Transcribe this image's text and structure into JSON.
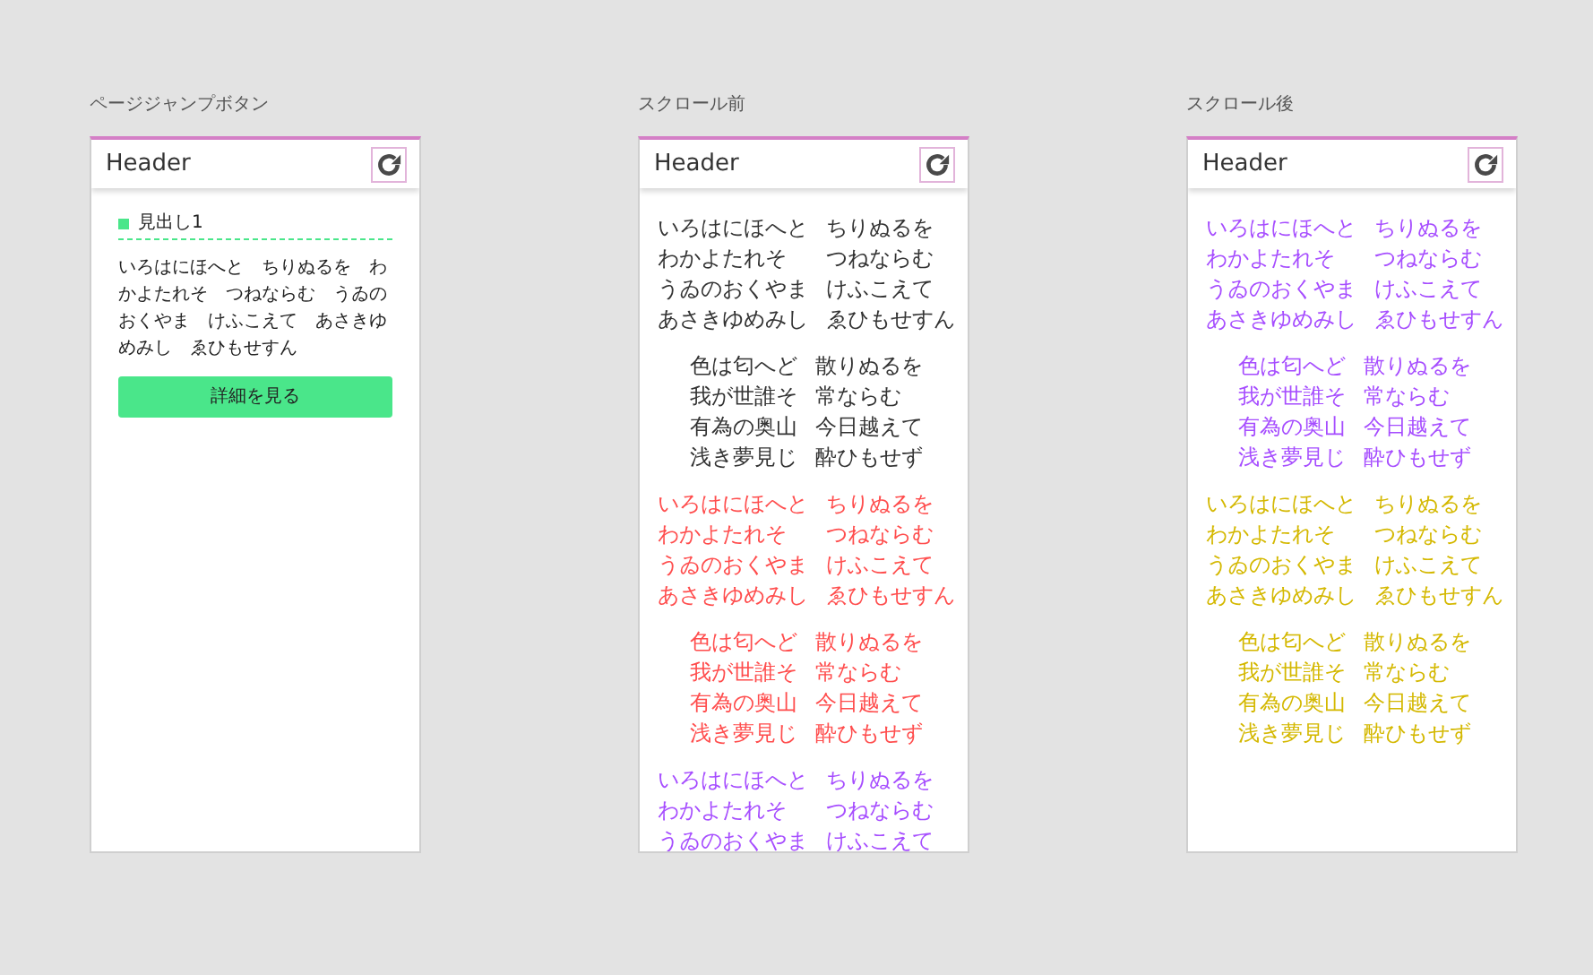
{
  "screens": [
    {
      "caption": "ページジャンプボタン",
      "header": {
        "title": "Header"
      },
      "kind": "detail",
      "heading": "見出し1",
      "body": "いろはにほへと　ちりぬるを　わかよたれそ　つねならむ　うゐのおくやま　けふこえて　あさきゆめみし　ゑひもせすん",
      "button": "詳細を見る"
    },
    {
      "caption": "スクロール前",
      "header": {
        "title": "Header"
      },
      "kind": "scroll",
      "stanzas": [
        {
          "kind": "kana",
          "color": "#333333",
          "lines": [
            [
              "いろはにほへと",
              "ちりぬるを"
            ],
            [
              "わかよたれそ",
              "つねならむ"
            ],
            [
              "うゐのおくやま",
              "けふこえて"
            ],
            [
              "あさきゆめみし",
              "ゑひもせすん"
            ]
          ]
        },
        {
          "kind": "kanji",
          "color": "#333333",
          "lines": [
            [
              "色は匂へど",
              "散りぬるを"
            ],
            [
              "我が世誰そ",
              "常ならむ"
            ],
            [
              "有為の奥山",
              "今日越えて"
            ],
            [
              "浅き夢見じ",
              "酔ひもせず"
            ]
          ]
        },
        {
          "kind": "kana",
          "color": "#ff4d4d",
          "lines": [
            [
              "いろはにほへと",
              "ちりぬるを"
            ],
            [
              "わかよたれそ",
              "つねならむ"
            ],
            [
              "うゐのおくやま",
              "けふこえて"
            ],
            [
              "あさきゆめみし",
              "ゑひもせすん"
            ]
          ]
        },
        {
          "kind": "kanji",
          "color": "#ff4d4d",
          "lines": [
            [
              "色は匂へど",
              "散りぬるを"
            ],
            [
              "我が世誰そ",
              "常ならむ"
            ],
            [
              "有為の奥山",
              "今日越えて"
            ],
            [
              "浅き夢見じ",
              "酔ひもせず"
            ]
          ]
        },
        {
          "kind": "kana",
          "color": "#a64dff",
          "lines": [
            [
              "いろはにほへと",
              "ちりぬるを"
            ],
            [
              "わかよたれそ",
              "つねならむ"
            ],
            [
              "うゐのおくやま",
              "けふこえて"
            ]
          ]
        }
      ]
    },
    {
      "caption": "スクロール後",
      "header": {
        "title": "Header"
      },
      "kind": "scroll",
      "stanzas": [
        {
          "kind": "kana",
          "color": "#a64dff",
          "lines": [
            [
              "いろはにほへと",
              "ちりぬるを"
            ],
            [
              "わかよたれそ",
              "つねならむ"
            ],
            [
              "うゐのおくやま",
              "けふこえて"
            ],
            [
              "あさきゆめみし",
              "ゑひもせすん"
            ]
          ]
        },
        {
          "kind": "kanji",
          "color": "#a64dff",
          "lines": [
            [
              "色は匂へど",
              "散りぬるを"
            ],
            [
              "我が世誰そ",
              "常ならむ"
            ],
            [
              "有為の奥山",
              "今日越えて"
            ],
            [
              "浅き夢見じ",
              "酔ひもせず"
            ]
          ]
        },
        {
          "kind": "kana",
          "color": "#d4b800",
          "lines": [
            [
              "いろはにほへと",
              "ちりぬるを"
            ],
            [
              "わかよたれそ",
              "つねならむ"
            ],
            [
              "うゐのおくやま",
              "けふこえて"
            ],
            [
              "あさきゆめみし",
              "ゑひもせすん"
            ]
          ]
        },
        {
          "kind": "kanji",
          "color": "#d4b800",
          "lines": [
            [
              "色は匂へど",
              "散りぬるを"
            ],
            [
              "我が世誰そ",
              "常ならむ"
            ],
            [
              "有為の奥山",
              "今日越えて"
            ],
            [
              "浅き夢見じ",
              "酔ひもせず"
            ]
          ]
        }
      ]
    }
  ]
}
